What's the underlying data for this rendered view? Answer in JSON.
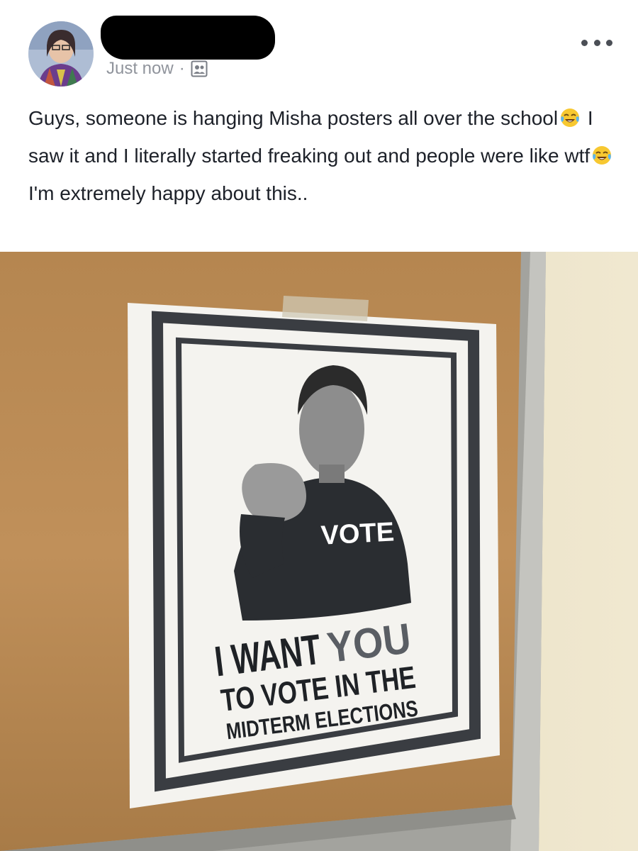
{
  "post": {
    "author_name": "",
    "timestamp": "Just now",
    "separator": "·",
    "audience_icon": "friends-icon",
    "more_icon": "more-dots-icon",
    "text_part1": "Guys, someone is hanging Misha posters all over the school",
    "emoji_1": "face-with-tears-of-joy",
    "text_part2": " I saw it and I literally started freaking out and people were like wtf",
    "emoji_2": "face-with-tears-of-joy",
    "text_part3": " I'm extremely happy about this.."
  },
  "photo": {
    "poster": {
      "shirt_text": "VOTE",
      "line1_a": "I WANT",
      "line1_b": "YOU",
      "line2": "TO VOTE IN THE",
      "line3": "MIDTERM ELECTIONS"
    }
  },
  "colors": {
    "text": "#1d2129",
    "meta": "#90949c",
    "corkboard": "#b8874f",
    "wall": "#ece4c8",
    "frame": "#a9a9a4",
    "poster_border": "#2c2f33"
  }
}
